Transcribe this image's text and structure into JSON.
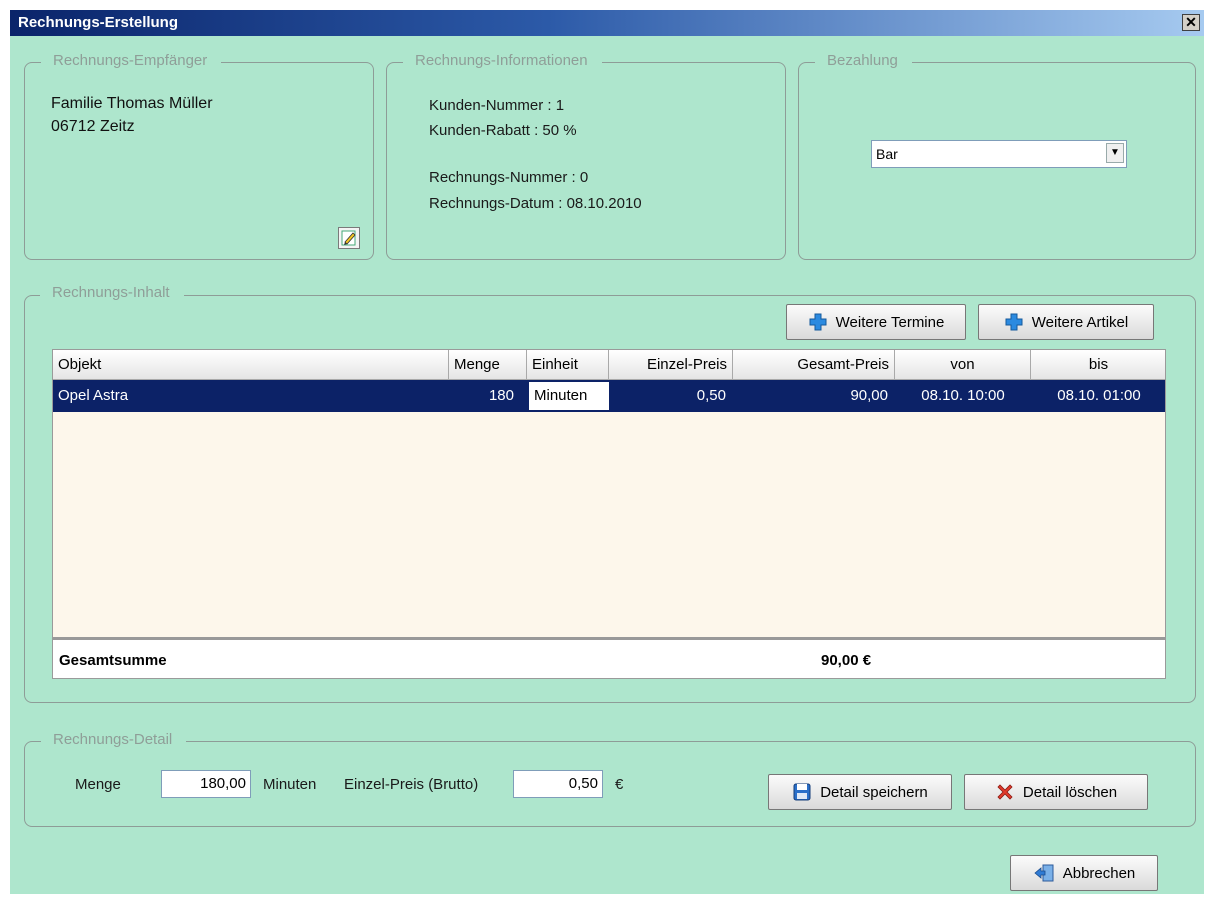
{
  "window": {
    "title": "Rechnungs-Erstellung",
    "close_label": "✕"
  },
  "recipient": {
    "legend": "Rechnungs-Empfänger",
    "name": "Familie Thomas Müller",
    "city": "06712 Zeitz",
    "edit_icon": "edit-icon"
  },
  "info": {
    "legend": "Rechnungs-Informationen",
    "customer_number": "Kunden-Nummer : 1",
    "customer_discount": "Kunden-Rabatt : 50 %",
    "invoice_number": "Rechnungs-Nummer : 0",
    "invoice_date": "Rechnungs-Datum :  08.10.2010"
  },
  "payment": {
    "legend": "Bezahlung",
    "selected": "Bar"
  },
  "content": {
    "legend": "Rechnungs-Inhalt",
    "btn_termine": "Weitere Termine",
    "btn_artikel": "Weitere Artikel",
    "columns": [
      "Objekt",
      "Menge",
      "Einheit",
      "Einzel-Preis",
      "Gesamt-Preis",
      "von",
      "bis"
    ],
    "rows": [
      {
        "objekt": "Opel Astra",
        "menge": "180",
        "einheit": "Minuten",
        "einzelpreis": "0,50",
        "gesamtpreis": "90,00",
        "von": "08.10.  10:00",
        "bis": "08.10.  01:00"
      }
    ],
    "total_label": "Gesamtsumme",
    "total_value": "90,00 €"
  },
  "detail": {
    "legend": "Rechnungs-Detail",
    "menge_label": "Menge",
    "menge_value": "180,00",
    "unit_label": "Minuten",
    "price_label": "Einzel-Preis (Brutto)",
    "price_value": "0,50",
    "currency": "€",
    "btn_save": "Detail speichern",
    "btn_delete": "Detail löschen"
  },
  "footer": {
    "btn_cancel": "Abbrechen"
  },
  "colors": {
    "background": "#aee6cd",
    "selection": "#0c2267",
    "title_start": "#0a246a",
    "title_end": "#a6caf0"
  }
}
